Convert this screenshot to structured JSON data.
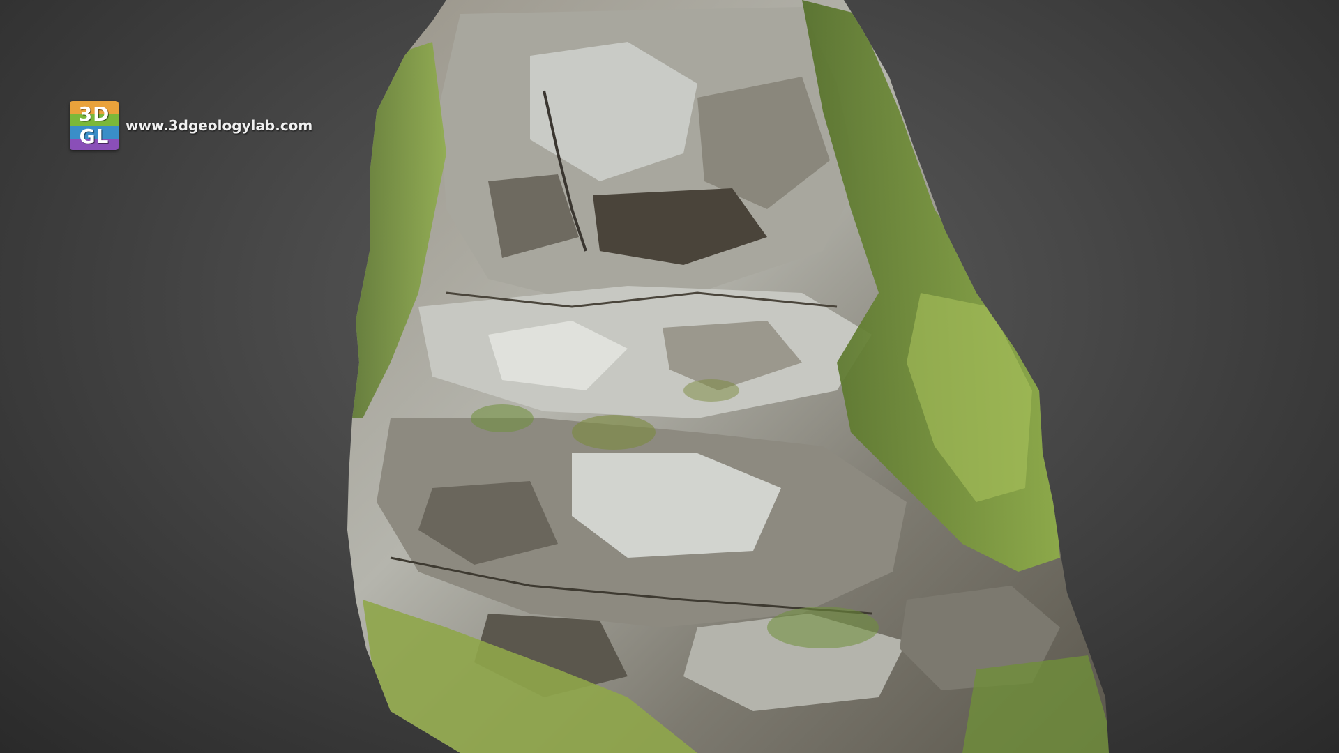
{
  "branding": {
    "logo_line1": "3D",
    "logo_line2": "GL",
    "url": "www.3dgeologylab.com"
  },
  "scene": {
    "subject": "rock-outcrop-3d-model",
    "colors": {
      "background_center": "#5e5e5e",
      "background_edge": "#2a2a2a",
      "rock_light": "#c9cbc6",
      "rock_mid": "#8a8a82",
      "rock_dark": "#3a3630",
      "vegetation": "#6f8f3a",
      "vegetation_light": "#a9c25c",
      "grass": "#8fa64a"
    }
  }
}
